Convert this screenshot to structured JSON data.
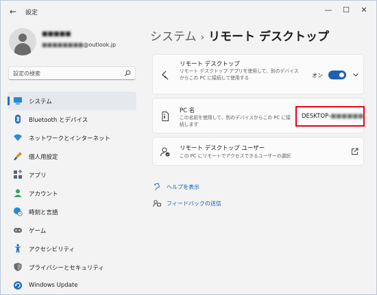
{
  "window": {
    "title": "設定",
    "back_glyph": "←",
    "controls": {
      "minimize": "—",
      "maximize": "☐",
      "close": "✕"
    }
  },
  "profile": {
    "name": "■■■■■",
    "email_prefix": "■■■■■■■■",
    "email_domain": "@outlook.jp"
  },
  "search": {
    "placeholder": "設定の検索",
    "icon": "search-icon"
  },
  "nav": {
    "items": [
      {
        "label": "システム",
        "icon": "system-icon",
        "color": "#0f6cbd",
        "active": true
      },
      {
        "label": "Bluetooth とデバイス",
        "icon": "bluetooth-icon",
        "color": "#1f6bc1"
      },
      {
        "label": "ネットワークとインターネット",
        "icon": "wifi-icon",
        "color": "#2a8adb"
      },
      {
        "label": "個人用設定",
        "icon": "brush-icon",
        "color": "#d18f2e"
      },
      {
        "label": "アプリ",
        "icon": "apps-icon",
        "color": "#566477"
      },
      {
        "label": "アカウント",
        "icon": "account-icon",
        "color": "#2fa36b"
      },
      {
        "label": "時刻と言語",
        "icon": "globe-clock-icon",
        "color": "#1f8bd6"
      },
      {
        "label": "ゲーム",
        "icon": "gamepad-icon",
        "color": "#6b6b6b"
      },
      {
        "label": "アクセシビリティ",
        "icon": "accessibility-icon",
        "color": "#1f6bc1"
      },
      {
        "label": "プライバシーとセキュリティ",
        "icon": "shield-icon",
        "color": "#6b6b6b"
      },
      {
        "label": "Windows Update",
        "icon": "update-icon",
        "color": "#1f6bc1"
      }
    ]
  },
  "breadcrumb": {
    "parent": "システム",
    "separator": "›",
    "current": "リモート デスクトップ"
  },
  "cards": {
    "remote_desktop": {
      "title": "リモート デスクトップ",
      "desc": "リモート デスクトップ アプリを使用して、別のデバイスからこの PC に接続して使用する",
      "toggle_label": "オン",
      "toggle_on": true
    },
    "pc_name": {
      "title": "PC 名",
      "desc": "この名前を使用して、別のデバイスからこの PC に接続します",
      "value_prefix": "DESKTOP-",
      "value_hidden": "■■■■■■"
    },
    "remote_users": {
      "title": "リモート デスクトップ ユーザー",
      "desc": "この PC にリモートでアクセスできるユーザーの選択"
    }
  },
  "links": [
    {
      "label": "ヘルプを表示",
      "icon": "help-icon"
    },
    {
      "label": "フィードバックの送信",
      "icon": "feedback-icon"
    }
  ],
  "colors": {
    "accent": "#1f5fb4",
    "highlight_border": "#e60012",
    "link": "#0f5cb4"
  }
}
